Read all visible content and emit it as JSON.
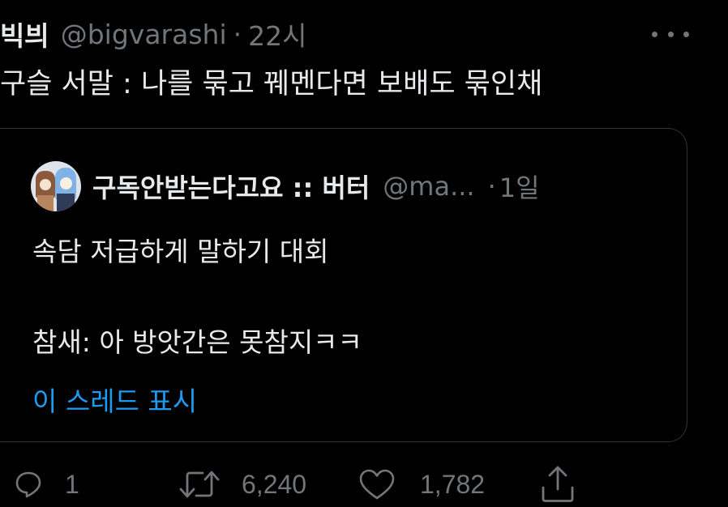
{
  "tweet": {
    "display_name": "빅븨",
    "handle": "@bigvarashi",
    "separator": "·",
    "time": "22시",
    "text": "구슬 서말 : 나를 묶고 꿰멘다면 보배도 묶인채"
  },
  "quote": {
    "display_name": "구독안받는다고요 :: 버터",
    "handle": "@ma...",
    "separator": "·",
    "time": "1일",
    "line1": "속담 저급하게 말하기 대회",
    "line2": "참새: 아 방앗간은 못참지ㅋㅋ",
    "show_thread": "이 스레드 표시"
  },
  "actions": {
    "reply_count": "1",
    "retweet_count": "6,240",
    "like_count": "1,782"
  },
  "colors": {
    "background": "#000000",
    "text": "#e7e9ea",
    "secondary": "#71767b",
    "link": "#1d9bf0",
    "border": "#2f3336"
  }
}
